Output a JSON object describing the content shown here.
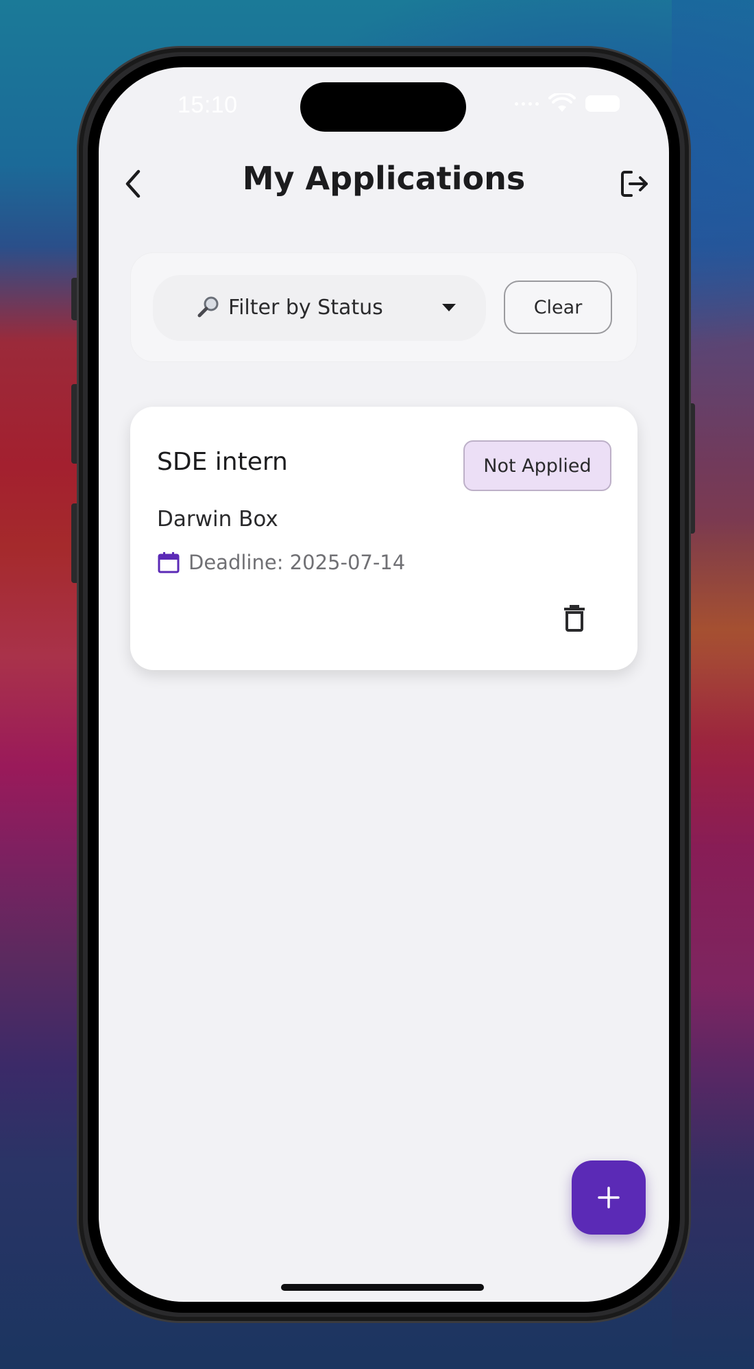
{
  "status_bar": {
    "time": "15:10"
  },
  "header": {
    "title": "My Applications",
    "back_icon": "chevron-left-icon",
    "logout_icon": "logout-icon"
  },
  "filter": {
    "select_label": "Filter by Status",
    "select_icon": "magnifier-icon",
    "clear_label": "Clear"
  },
  "applications": [
    {
      "title": "SDE intern",
      "status": "Not Applied",
      "company": "Darwin Box",
      "deadline_text": "Deadline: 2025-07-14"
    }
  ],
  "fab": {
    "label": "+",
    "icon": "plus-icon"
  },
  "colors": {
    "accent": "#5b2ab6",
    "badge_bg": "#ecdff6",
    "screen_bg": "#f2f2f5"
  }
}
